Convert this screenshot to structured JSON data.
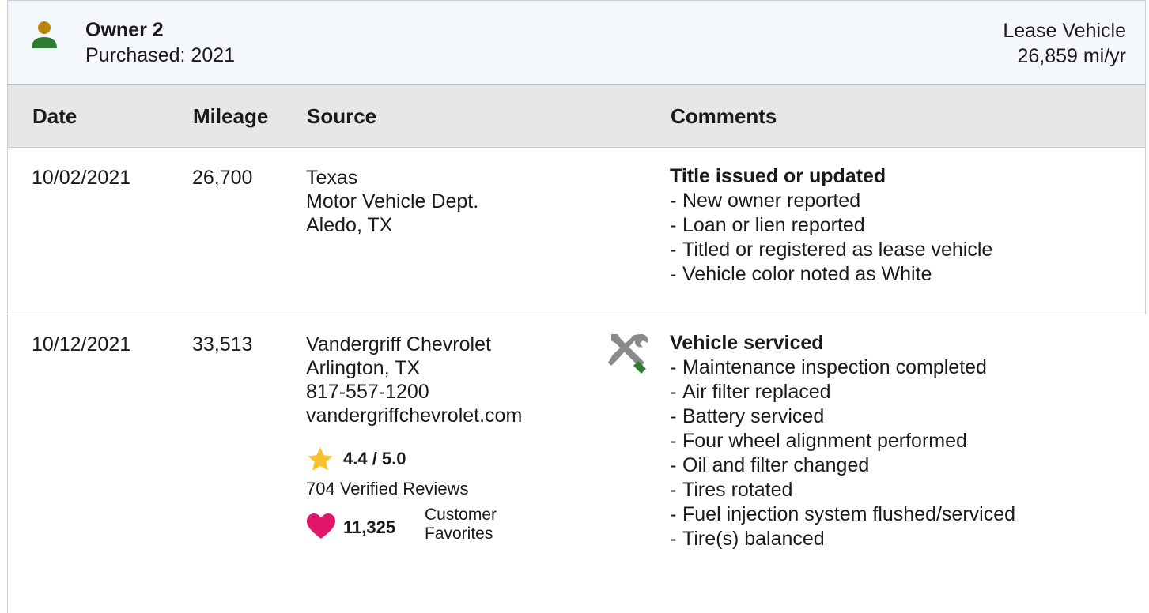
{
  "owner": {
    "name": "Owner 2",
    "purchased": "Purchased: 2021",
    "vehicle_type": "Lease Vehicle",
    "miles_per_year": "26,859 mi/yr"
  },
  "columns": {
    "date": "Date",
    "mileage": "Mileage",
    "source": "Source",
    "comments": "Comments"
  },
  "records": [
    {
      "date": "10/02/2021",
      "mileage": "26,700",
      "source": [
        "Texas",
        "Motor Vehicle Dept.",
        "Aledo, TX"
      ],
      "comment_title": "Title issued or updated",
      "comment_items": [
        "New owner reported",
        "Loan or lien reported",
        "Titled or registered as lease vehicle",
        "Vehicle color noted as White"
      ]
    },
    {
      "date": "10/12/2021",
      "mileage": "33,513",
      "source": [
        "Vandergriff Chevrolet",
        "Arlington, TX",
        "817-557-1200",
        "vandergriffchevrolet.com"
      ],
      "rating": "4.4 / 5.0",
      "reviews": "704 Verified Reviews",
      "favorites_count": "11,325",
      "favorites_label": [
        "Customer",
        "Favorites"
      ],
      "icon": "service-tools-icon",
      "comment_title": "Vehicle serviced",
      "comment_items": [
        "Maintenance inspection completed",
        "Air filter replaced",
        "Battery serviced",
        "Four wheel alignment performed",
        "Oil and filter changed",
        "Tires rotated",
        "Fuel injection system flushed/serviced",
        "Tire(s) balanced"
      ]
    }
  ],
  "colors": {
    "owner_icon_head": "#b8860b",
    "owner_icon_body": "#2e7d32",
    "star": "#fbc02d",
    "heart": "#e0156b",
    "tool_grey": "#8a8a8a",
    "tool_green": "#2e7d32",
    "header_bg": "#e7e7e7",
    "owner_bg": "#f4f8fc"
  },
  "dash": "-"
}
